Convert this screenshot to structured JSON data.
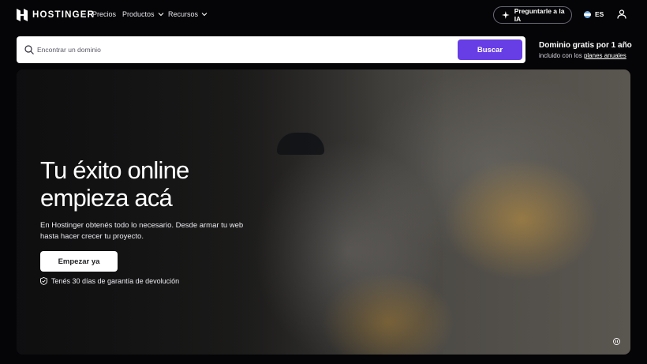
{
  "nav": {
    "brand": "HOSTINGER",
    "links": [
      "Precios",
      "Productos",
      "Recursos"
    ],
    "ai_button": "Preguntarle a la IA",
    "language": "ES"
  },
  "search": {
    "placeholder": "Encontrar un dominio",
    "button": "Buscar"
  },
  "promo": {
    "title": "Dominio gratis por 1 año",
    "prefix": "incluido con los",
    "link": "planes anuales"
  },
  "hero": {
    "title_line1": "Tu éxito online",
    "title_line2": "empieza acá",
    "lead": "En Hostinger obtenés todo lo necesario. Desde armar tu web hasta hacer crecer tu proyecto.",
    "cta": "Empezar ya",
    "guarantee": "Tenés 30 días de garantía de devolución"
  },
  "colors": {
    "accent": "#673de6",
    "background": "#050507"
  },
  "icons": [
    "hostinger-logo-icon",
    "chevron-down-icon",
    "sparkle-icon",
    "flag-icon",
    "user-icon",
    "search-icon",
    "shield-check-icon",
    "pause-icon"
  ]
}
